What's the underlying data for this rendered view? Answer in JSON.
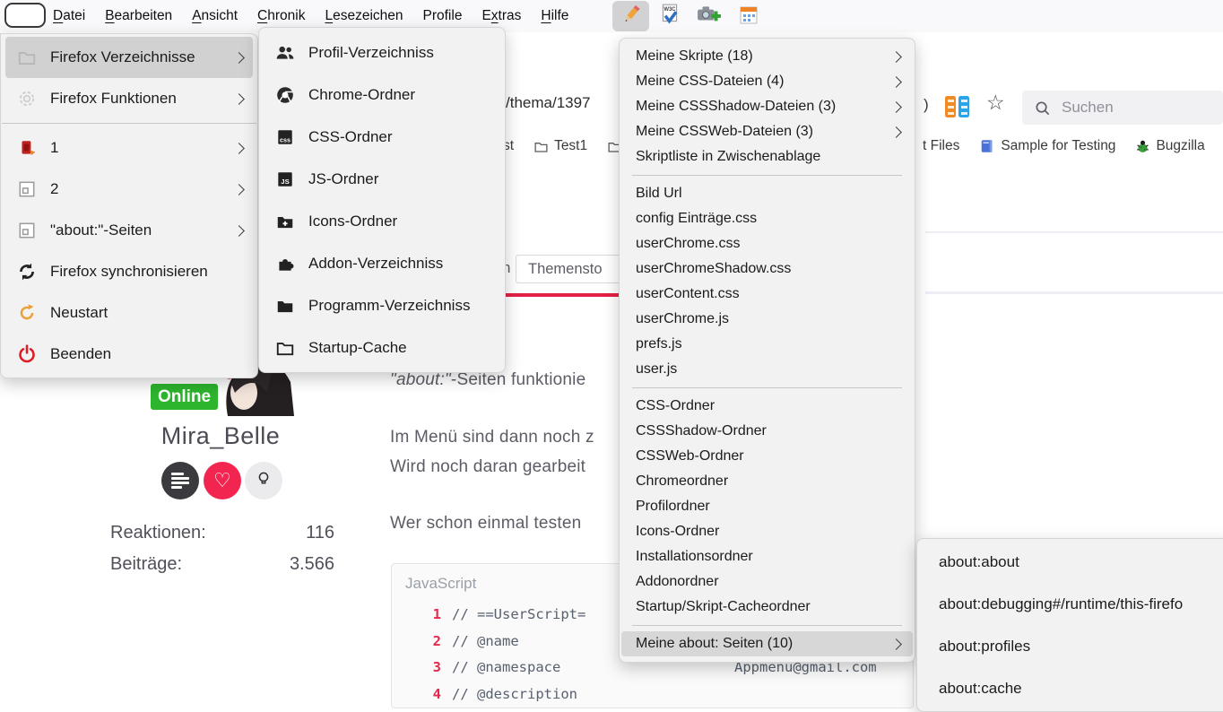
{
  "colors": {
    "accent_red": "#e32045",
    "online_green": "#2db52d",
    "heart_red": "#f22550",
    "code_number_red": "#e02a4d",
    "menu_highlight": "#d1d1d1"
  },
  "menubar": {
    "items": [
      {
        "pre": "",
        "key": "D",
        "post": "atei"
      },
      {
        "pre": "",
        "key": "B",
        "post": "earbeiten"
      },
      {
        "pre": "",
        "key": "A",
        "post": "nsicht"
      },
      {
        "pre": "",
        "key": "C",
        "post": "hronik"
      },
      {
        "pre": "",
        "key": "L",
        "post": "esezeichen"
      },
      {
        "pre": "Profile",
        "key": "",
        "post": ""
      },
      {
        "pre": "E",
        "key": "x",
        "post": "tras"
      },
      {
        "pre": "",
        "key": "H",
        "post": "ilfe"
      }
    ]
  },
  "toolbar": {
    "buttons": [
      {
        "name": "userchromejs-menu-button",
        "icon": "pencil-icon",
        "active": true
      },
      {
        "name": "w3c-validator-button",
        "icon": "w3c-check-icon",
        "active": false
      },
      {
        "name": "screenshot-button",
        "icon": "camera-plus-icon",
        "active": false
      },
      {
        "name": "table-button",
        "icon": "orange-table-icon",
        "active": false
      }
    ]
  },
  "navbar": {
    "url_fragment": "/thema/1397",
    "paren_fragment": ")",
    "search_placeholder": "Suchen",
    "extension_icons": [
      "orange-battery-icon",
      "blue-battery-icon"
    ],
    "bookmark_star_icon": "star-icon"
  },
  "bookmarks": {
    "left_fragment": "st",
    "folder1_label": "Test1",
    "right_fragment": "t Files",
    "sample_label": "Sample for Testing",
    "bugzilla_label": "Bugzilla"
  },
  "page": {
    "tab_left_fragment": "n",
    "tab_label": "Themensto",
    "profile": {
      "status": "Online",
      "username": "Mira_Belle",
      "stats": [
        {
          "label": "Reaktionen:",
          "value": "116"
        },
        {
          "label": "Beiträge:",
          "value": "3.566"
        }
      ]
    },
    "paragraphs": {
      "p1_italic": "\"about:\"",
      "p1_rest": "-Seiten funktionie",
      "p2": "Im Menü sind dann noch z",
      "p3": "Wird noch daran gearbeit",
      "p4": "Wer schon einmal testen"
    },
    "code": {
      "language": "JavaScript",
      "lines": [
        {
          "num": "1",
          "text": "// ==UserScript="
        },
        {
          "num": "2",
          "text": "// @name"
        },
        {
          "num": "3",
          "text": "// @namespace",
          "value": "Appmenu@gmail.com"
        },
        {
          "num": "4",
          "text": "// @description"
        }
      ]
    }
  },
  "menus": {
    "menu1": {
      "items": [
        {
          "label": "Firefox Verzeichnisse",
          "icon": "folder-outline-icon",
          "submenu": true,
          "highlighted": true
        },
        {
          "label": "Firefox Funktionen",
          "icon": "gear-icon",
          "submenu": true,
          "highlighted": false
        },
        {
          "label": "1",
          "icon": "userchrome-logo-icon",
          "submenu": true,
          "highlighted": false
        },
        {
          "label": "2",
          "icon": "window-frame-icon",
          "submenu": true,
          "highlighted": false
        },
        {
          "label": "\"about:\"-Seiten",
          "icon": "window-frame-icon",
          "submenu": true,
          "highlighted": false
        },
        {
          "label": "Firefox synchronisieren",
          "icon": "sync-icon",
          "submenu": false,
          "highlighted": false
        },
        {
          "label": "Neustart",
          "icon": "restart-icon",
          "submenu": false,
          "highlighted": false
        },
        {
          "label": "Beenden",
          "icon": "power-icon",
          "submenu": false,
          "highlighted": false
        }
      ]
    },
    "menu2": {
      "items": [
        {
          "label": "Profil-Verzeichniss",
          "icon": "people-icon"
        },
        {
          "label": "Chrome-Ordner",
          "icon": "chrome-icon"
        },
        {
          "label": "CSS-Ordner",
          "icon": "css-badge-icon"
        },
        {
          "label": "JS-Ordner",
          "icon": "js-badge-icon"
        },
        {
          "label": "Icons-Ordner",
          "icon": "folder-plus-icon"
        },
        {
          "label": "Addon-Verzeichniss",
          "icon": "puzzle-icon"
        },
        {
          "label": "Programm-Verzeichniss",
          "icon": "folder-filled-icon"
        },
        {
          "label": "Startup-Cache",
          "icon": "folder-outline-dark-icon"
        }
      ]
    },
    "menu3": {
      "items": [
        {
          "label": "Meine Skripte (18)",
          "submenu": true,
          "highlighted": false
        },
        {
          "label": "Meine CSS-Dateien (4)",
          "submenu": true,
          "highlighted": false
        },
        {
          "label": "Meine CSSShadow-Dateien (3)",
          "submenu": true,
          "highlighted": false
        },
        {
          "label": "Meine CSSWeb-Dateien (3)",
          "submenu": true,
          "highlighted": false
        },
        {
          "label": "Skriptliste in Zwischenablage",
          "submenu": false,
          "highlighted": false
        },
        {
          "label": "Bild Url",
          "submenu": false,
          "highlighted": false
        },
        {
          "label": "config Einträge.css",
          "submenu": false,
          "highlighted": false
        },
        {
          "label": "userChrome.css",
          "submenu": false,
          "highlighted": false
        },
        {
          "label": "userChromeShadow.css",
          "submenu": false,
          "highlighted": false
        },
        {
          "label": "userContent.css",
          "submenu": false,
          "highlighted": false
        },
        {
          "label": "userChrome.js",
          "submenu": false,
          "highlighted": false
        },
        {
          "label": "prefs.js",
          "submenu": false,
          "highlighted": false
        },
        {
          "label": "user.js",
          "submenu": false,
          "highlighted": false
        },
        {
          "label": "CSS-Ordner",
          "submenu": false,
          "highlighted": false
        },
        {
          "label": "CSSShadow-Ordner",
          "submenu": false,
          "highlighted": false
        },
        {
          "label": "CSSWeb-Ordner",
          "submenu": false,
          "highlighted": false
        },
        {
          "label": "Chromeordner",
          "submenu": false,
          "highlighted": false
        },
        {
          "label": "Profilordner",
          "submenu": false,
          "highlighted": false
        },
        {
          "label": "Icons-Ordner",
          "submenu": false,
          "highlighted": false
        },
        {
          "label": "Installationsordner",
          "submenu": false,
          "highlighted": false
        },
        {
          "label": "Addonordner",
          "submenu": false,
          "highlighted": false
        },
        {
          "label": "Startup/Skript-Cacheordner",
          "submenu": false,
          "highlighted": false
        },
        {
          "label": "Meine about: Seiten (10)",
          "submenu": true,
          "highlighted": true
        }
      ]
    },
    "menu4": {
      "items": [
        {
          "label": "about:about"
        },
        {
          "label": "about:debugging#/runtime/this-firefo"
        },
        {
          "label": "about:profiles"
        },
        {
          "label": "about:cache"
        }
      ]
    }
  }
}
